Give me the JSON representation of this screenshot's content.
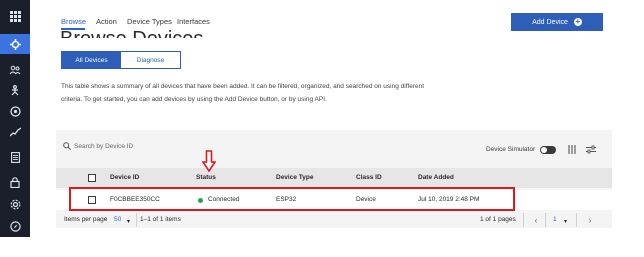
{
  "nav": {
    "tabs": [
      "Browse",
      "Action",
      "Device Types",
      "Interfaces"
    ],
    "add_button": "Add Device"
  },
  "page": {
    "heading": "Browse Devices",
    "segments": [
      "All Devices",
      "Diagnose"
    ],
    "description_line1": "This table shows a summary of all devices that have been added. It can be filtered, organized, and searched on using different",
    "description_line2": "criteria. To get started, you can add devices by using the Add Device button, or by using API."
  },
  "toolbar": {
    "search_placeholder": "Search by Device ID",
    "simulator_label": "Device Simulator"
  },
  "table": {
    "headers": [
      "Device ID",
      "Status",
      "Device Type",
      "Class ID",
      "Date Added"
    ],
    "rows": [
      {
        "device_id": "F0CBBEE350CC",
        "status": "Connected",
        "device_type": "ESP32",
        "class_id": "Device",
        "date_added": "Jul 10, 2019 2:48 PM"
      }
    ]
  },
  "pagination": {
    "items_per_page_label": "Items per page",
    "items_per_page_value": "50",
    "range": "1–1 of 1 items",
    "pages": "1 of 1 pages",
    "current_page": "1"
  },
  "colors": {
    "rail": "#1a1f2b",
    "accent": "#2d5fb8",
    "highlight": "#d61c1c",
    "status_connected": "#2ea043"
  }
}
